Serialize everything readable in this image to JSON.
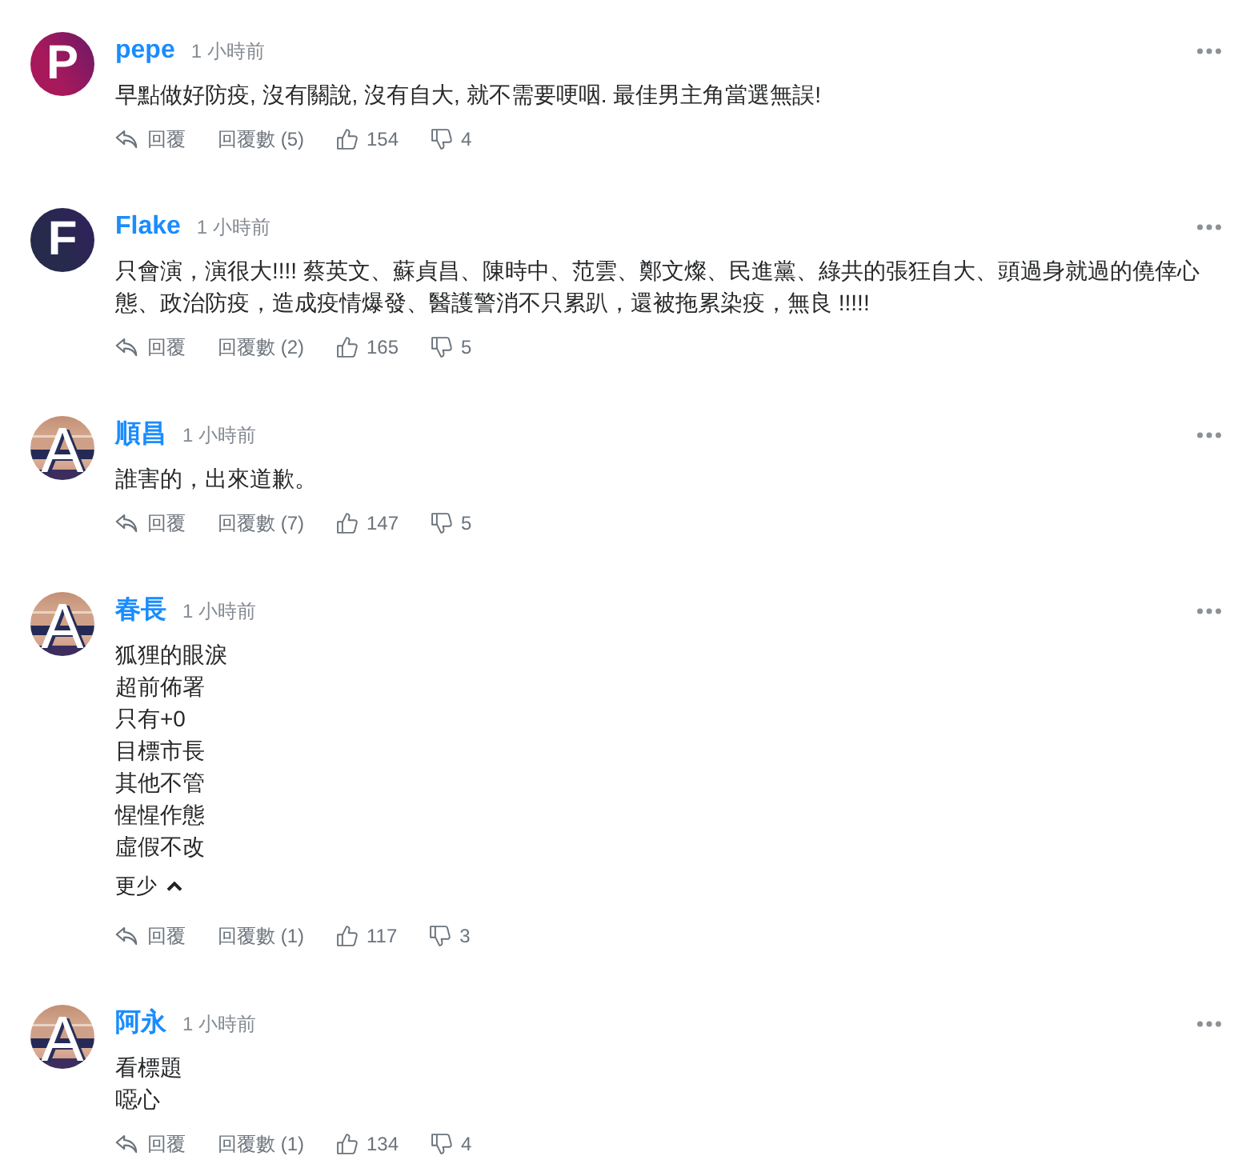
{
  "comments": [
    {
      "avatar": {
        "kind": "letter",
        "letter": "P",
        "color": "#a8195c"
      },
      "name": "pepe",
      "time": "1 小時前",
      "lines": [
        "早點做好防疫, 沒有關說, 沒有自大, 就不需要哽咽. 最佳男主角當選無誤!"
      ],
      "reply_label": "回覆",
      "replies_label": "回覆數 (5)",
      "likes": "154",
      "dislikes": "4"
    },
    {
      "avatar": {
        "kind": "letter",
        "letter": "F",
        "color": "#262a4b"
      },
      "name": "Flake",
      "time": "1 小時前",
      "lines": [
        "只會演，演很大!!!! 蔡英文、蘇貞昌、陳時中、范雲、鄭文燦、民進黨、綠共的張狂自大、頭過身就過的僥倖心態、政治防疫，造成疫情爆發、醫護警消不只累趴，還被拖累染疫，無良 !!!!!"
      ],
      "reply_label": "回覆",
      "replies_label": "回覆數 (2)",
      "likes": "165",
      "dislikes": "5"
    },
    {
      "avatar": {
        "kind": "striped",
        "letter": "A"
      },
      "name": "順昌",
      "time": "1 小時前",
      "lines": [
        "誰害的，出來道歉。"
      ],
      "reply_label": "回覆",
      "replies_label": "回覆數 (7)",
      "likes": "147",
      "dislikes": "5"
    },
    {
      "avatar": {
        "kind": "striped",
        "letter": "A"
      },
      "name": "春長",
      "time": "1 小時前",
      "lines": [
        "狐狸的眼淚",
        "超前佈署",
        "只有+0",
        "目標市長",
        "其他不管",
        "惺惺作態",
        "虛假不改"
      ],
      "toggle": {
        "label": "更少",
        "expanded": true
      },
      "reply_label": "回覆",
      "replies_label": "回覆數 (1)",
      "likes": "117",
      "dislikes": "3"
    },
    {
      "avatar": {
        "kind": "striped",
        "letter": "A"
      },
      "name": "阿永",
      "time": "1 小時前",
      "lines": [
        "看標題",
        "噁心"
      ],
      "reply_label": "回覆",
      "replies_label": "回覆數 (1)",
      "likes": "134",
      "dislikes": "4"
    }
  ]
}
